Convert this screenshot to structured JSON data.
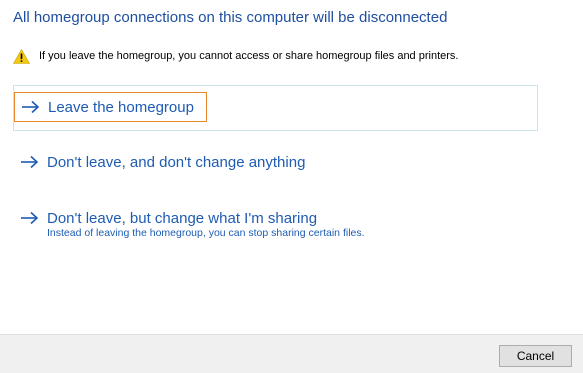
{
  "dialog": {
    "heading": "All homegroup connections on this computer will be disconnected",
    "warning": {
      "icon": "warning-icon",
      "icon_color": "#f2c811",
      "text": "If you leave the homegroup, you cannot access or share homegroup files and printers."
    },
    "options": [
      {
        "icon": "arrow-right-icon",
        "label": "Leave the homegroup",
        "description": "",
        "selected": true
      },
      {
        "icon": "arrow-right-icon",
        "label": "Don't leave, and don't change anything",
        "description": "",
        "selected": false
      },
      {
        "icon": "arrow-right-icon",
        "label": "Don't leave, but change what I'm sharing",
        "description": "Instead of leaving the homegroup, you can stop sharing certain files.",
        "selected": false
      }
    ]
  },
  "footer": {
    "cancel_label": "Cancel"
  },
  "colors": {
    "heading": "#1f4fa1",
    "link": "#1e5cb3",
    "focus_border": "#e8872a",
    "selected_border": "#cfe3ec"
  }
}
